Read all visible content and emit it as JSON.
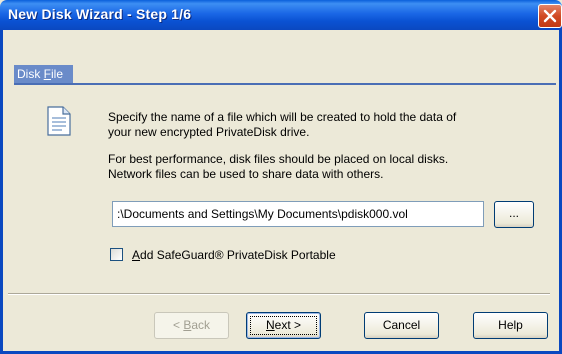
{
  "window": {
    "title": "New Disk Wizard - Step 1/6"
  },
  "section": {
    "title_prefix": "Disk ",
    "title_accel": "F",
    "title_rest": "ile"
  },
  "text": {
    "p1_line1": "Specify the name of a file which will be created to hold the data of",
    "p1_line2": "your new encrypted PrivateDisk drive.",
    "p2_line1": "For best performance, disk files should be placed on local disks.",
    "p2_line2": "Network files can be used to share data with others."
  },
  "file_path": {
    "value": ":\\Documents and Settings\\My Documents\\pdisk000.vol"
  },
  "browse_label": "...",
  "portable": {
    "checked": false,
    "label_accel": "A",
    "label_rest": "dd SafeGuard® PrivateDisk Portable"
  },
  "buttons": {
    "back_prefix": "< ",
    "back_accel": "B",
    "back_rest": "ack",
    "next_accel": "N",
    "next_rest": "ext >",
    "cancel": "Cancel",
    "help": "Help"
  },
  "colors": {
    "titlebar": "#0a52d3",
    "section": "#6a8bc9",
    "dialog_bg": "#ece9d8"
  }
}
